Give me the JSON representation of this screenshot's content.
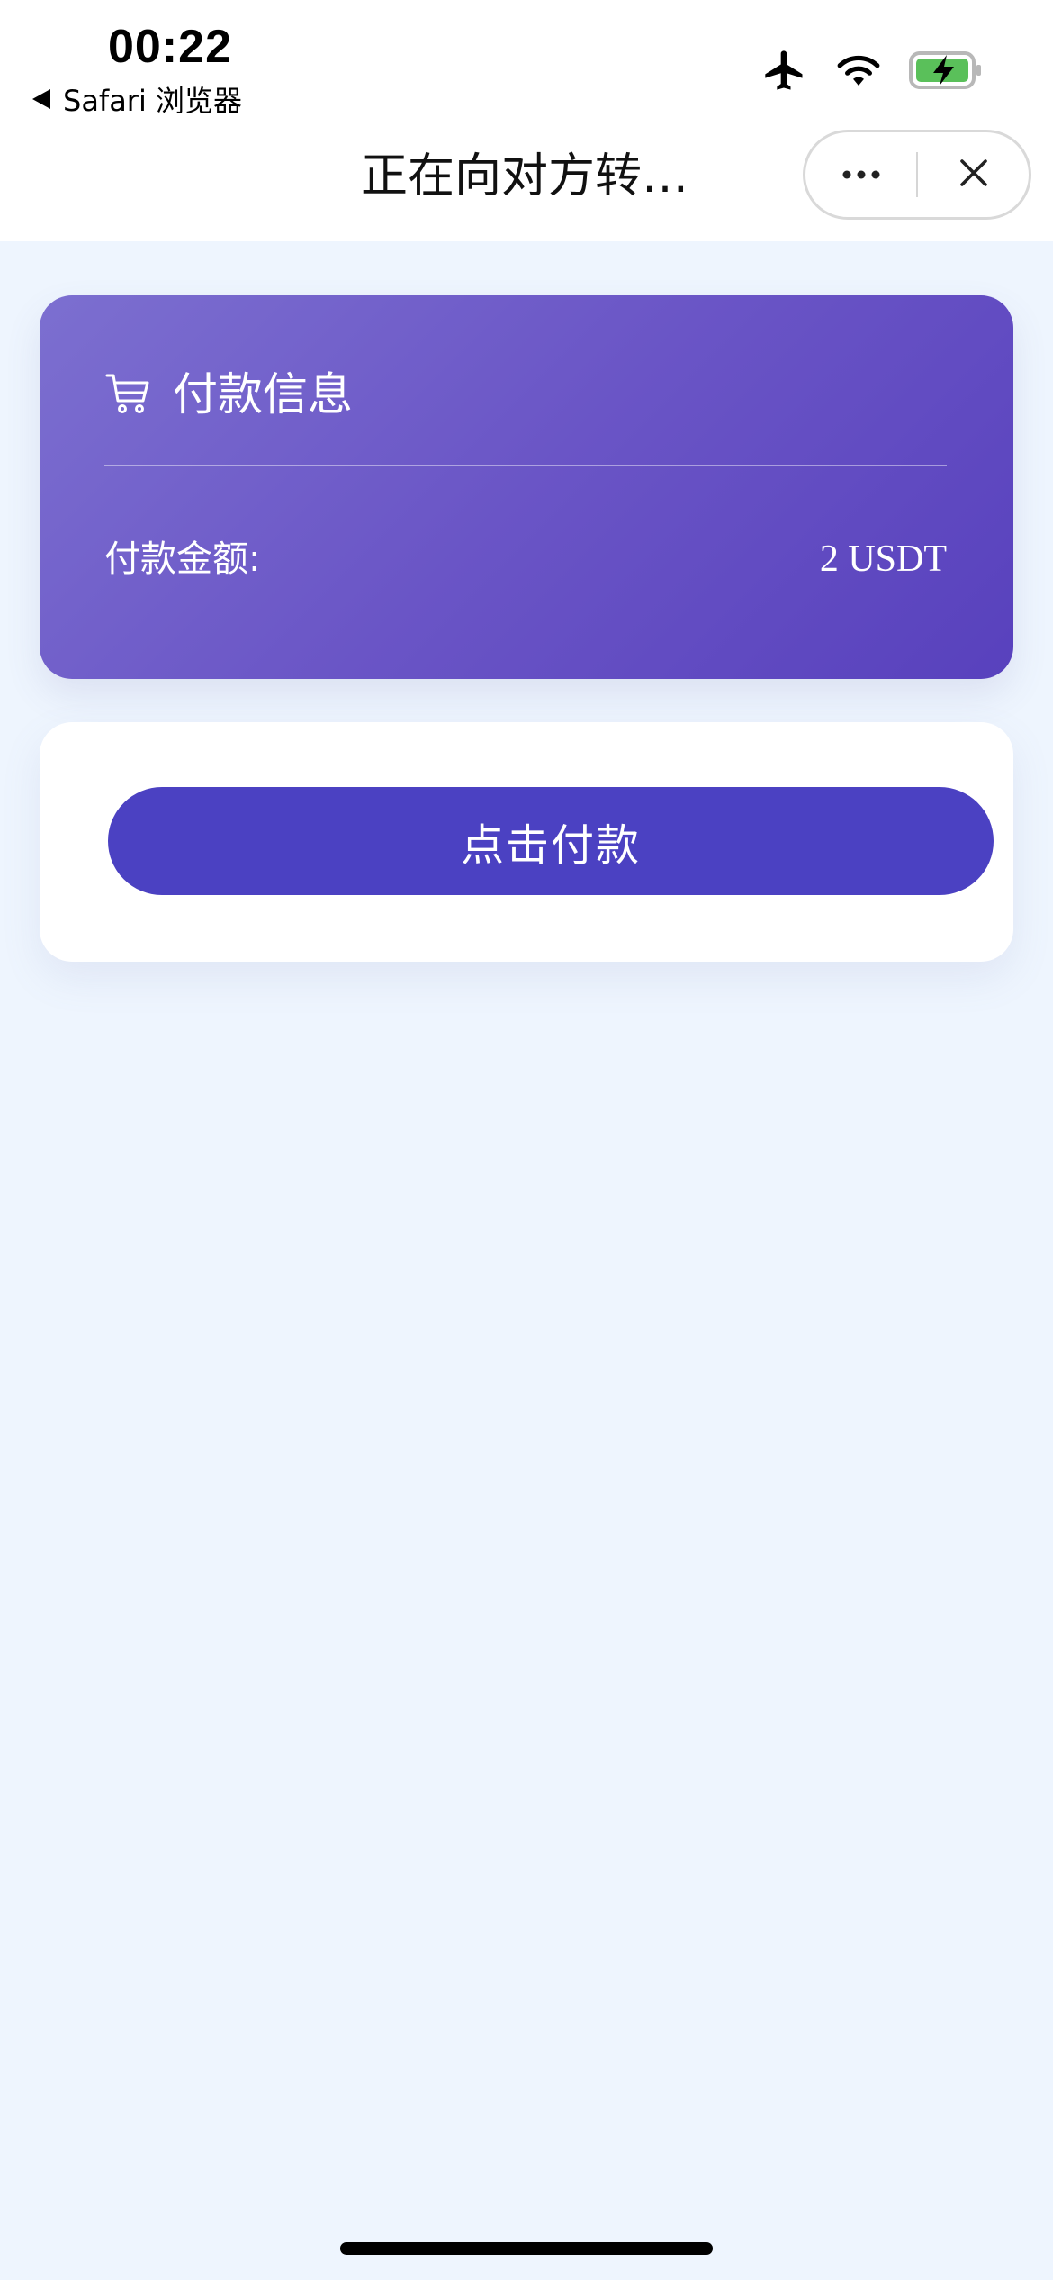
{
  "status_bar": {
    "time": "00:22",
    "back_app_label": "Safari 浏览器",
    "icons": [
      "airplane-icon",
      "wifi-icon",
      "battery-charging-icon"
    ],
    "battery_color": "#5ac05a"
  },
  "nav": {
    "title": "正在向对方转…",
    "menu_icon": "more-dots-icon",
    "close_icon": "close-icon"
  },
  "payment_info": {
    "icon": "cart-icon",
    "title": "付款信息",
    "amount_label": "付款金额:",
    "amount_value": "2 USDT",
    "gradient_colors": [
      "#7c6fd0",
      "#5841bd"
    ]
  },
  "action": {
    "pay_button_label": "点击付款",
    "button_color": "#4b41c2"
  },
  "colors": {
    "page_background": "#eef5fe",
    "card_background": "#ffffff"
  }
}
